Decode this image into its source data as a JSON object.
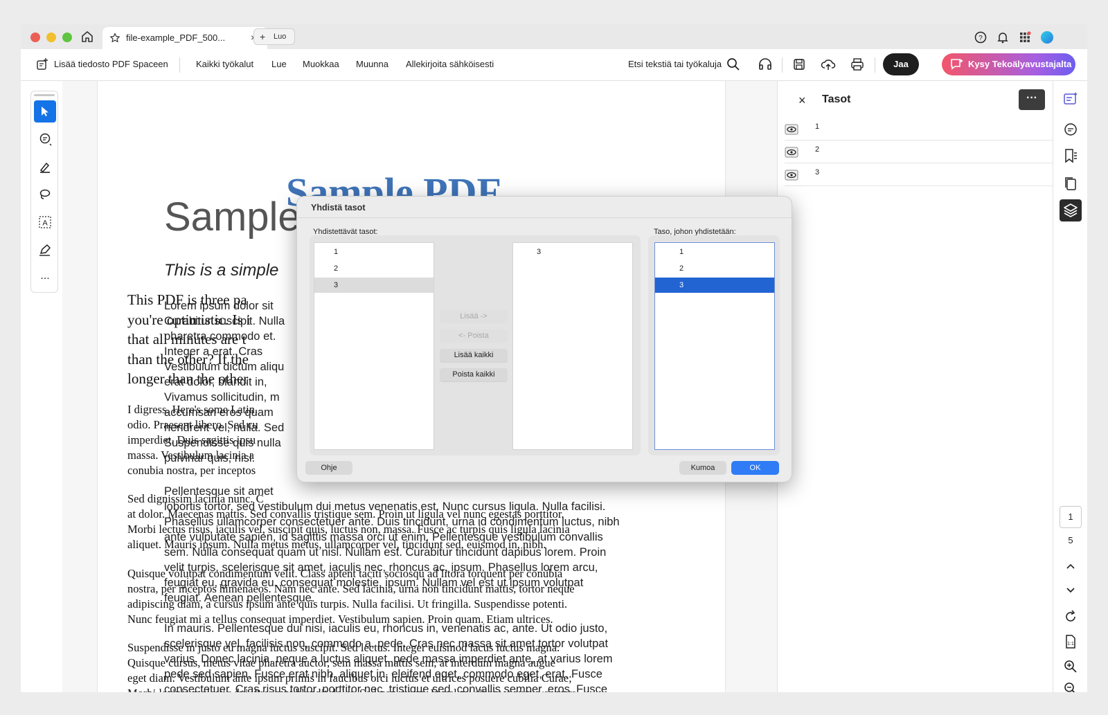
{
  "browser": {
    "tab_title": "file-example_PDF_500...",
    "tab_close": "×",
    "new_tab_plus": "+",
    "new_tab_label": "Luo"
  },
  "toolbar": {
    "add_file": "Lisää tiedosto PDF Spaceen",
    "all_tools": "Kaikki työkalut",
    "read": "Lue",
    "edit": "Muokkaa",
    "convert": "Muunna",
    "sign": "Allekirjoita sähköisesti",
    "search": "Etsi tekstiä tai työkaluja",
    "share": "Jaa",
    "ai_assistant": "Kysy Tekoälyavustajalta"
  },
  "left_tools": [
    "select-tool",
    "comment-tool",
    "highlight-tool",
    "draw-tool",
    "text-select-tool",
    "sign-tool",
    "more-tools"
  ],
  "left_more": "...",
  "document": {
    "big_title": "Sample PDF",
    "title_sans": "Sample",
    "subtitle_italic": "This is a simple",
    "serif_lines": [
      "This PDF is three pa",
      "you're optimistic. Is i",
      "that all minutes are t",
      "than the other? If the",
      "longer than the other"
    ],
    "serif_para2": [
      "I digress. Here's some Latin.",
      "odio. Praesent libero. Sed cu",
      "imperdiet. Duis sagittis ipsu",
      "massa. Vestibulum lacinia a",
      "conubia nostra, per inceptos"
    ],
    "serif_para3": [
      "Sed dignissim lacinia nunc. C",
      "at dolor. Maecenas mattis. Sed convallis tristique sem. Proin ut ligula vel nunc egestas porttitor.",
      "Morbi lectus risus, iaculis vel, suscipit quis, luctus non, massa. Fusce ac turpis quis ligula lacinia",
      "aliquet. Mauris ipsum. Nulla metus metus, ullamcorper vel, tincidunt sed, euismod in, nibh."
    ],
    "serif_para4": [
      "Quisque volutpat condimentum velit. Class aptent taciti sociosqu ad litora torquent per conubia",
      "nostra, per inceptos himenaeos. Nam nec ante. Sed lacinia, urna non tincidunt mattis, tortor neque",
      "adipiscing diam, a cursus ipsum ante quis turpis. Nulla facilisi. Ut fringilla. Suspendisse potenti.",
      "Nunc feugiat mi a tellus consequat imperdiet. Vestibulum sapien. Proin quam. Etiam ultrices."
    ],
    "serif_para5": [
      "Suspendisse in justo eu magna luctus suscipit. Sed lectus. Integer euismod lacus luctus magna.",
      "Quisque cursus, metus vitae pharetra auctor, sem massa mattis sem, at interdum magna augue",
      "eget diam. Vestibulum ante ipsum primis in faucibus orci luctus et ultrices posuere cubilia Curae;",
      "Morbi lacinia molestie dui. Praesent blandit dolor. Sed non quam. In vel mi sit amet augue congue"
    ],
    "sans_lines": [
      "Lorem ipsum dolor sit",
      "Curabitur suscipit. Nulla",
      "pharetra commodo et.",
      "Integer a erat. Cras",
      "Vestibulum dictum aliqu",
      "erat dolor, blandit in, ",
      "Vivamus sollicitudin, m",
      "accumsan eros quam",
      "hendrerit vel, nulla. Sed",
      "Suspendisse quis nulla",
      "pulvinar quis, nisl."
    ],
    "sans_para2": [
      "Pellentesque sit amet",
      "lobortis tortor, sed vestibulum dui metus venenatis est. Nunc cursus ligula. Nulla facilisi.",
      "Phasellus ullamcorper consectetuer ante. Duis tincidunt, urna id condimentum luctus, nibh",
      "ante vulputate sapien, id sagittis massa orci ut enim. Pellentesque vestibulum convallis",
      "sem. Nulla consequat quam ut nisl. Nullam est. Curabitur tincidunt dapibus lorem. Proin",
      "velit turpis, scelerisque sit amet, iaculis nec, rhoncus ac, ipsum. Phasellus lorem arcu,",
      "feugiat eu, gravida eu, consequat molestie, ipsum. Nullam vel est ut ipsum volutpat",
      "feugiat. Aenean pellentesque."
    ],
    "sans_para3": [
      "In mauris. Pellentesque dui nisi, iaculis eu, rhoncus in, venenatis ac, ante. Ut odio justo,",
      "scelerisque vel, facilisis non, commodo a, pede. Cras nec massa sit amet tortor volutpat",
      "varius. Donec lacinia, neque a luctus aliquet, pede massa imperdiet ante, at varius lorem",
      "pede sed sapien. Fusce erat nibh, aliquet in, eleifend eget, commodo eget, erat. Fusce",
      "consectetuer. Cras risus tortor, porttitor nec, tristique sed, convallis semper, eros. Fusce"
    ]
  },
  "layers_panel": {
    "title": "Tasot",
    "close": "×",
    "more": "···",
    "layers": [
      "1",
      "2",
      "3"
    ]
  },
  "page_nav": {
    "current": "1",
    "total": "5"
  },
  "dialog": {
    "title": "Yhdistä tasot",
    "left_label": "Yhdistettävät tasot:",
    "right_label": "Taso, johon yhdistetään:",
    "source_list": [
      "1",
      "2",
      "3"
    ],
    "source_selected": "3",
    "chosen_list": [
      "3"
    ],
    "target_list": [
      "1",
      "2",
      "3"
    ],
    "target_selected": "3",
    "btn_add": "Lisää ->",
    "btn_remove": "<- Poista",
    "btn_add_all": "Lisää kaikki",
    "btn_remove_all": "Poista kaikki",
    "btn_help": "Ohje",
    "btn_cancel": "Kumoa",
    "btn_ok": "OK"
  },
  "colors": {
    "accent_blue": "#1473e6",
    "list_selection": "#2264d1",
    "ok_button": "#2f7cf6",
    "title_blue": "#3f74b8"
  }
}
